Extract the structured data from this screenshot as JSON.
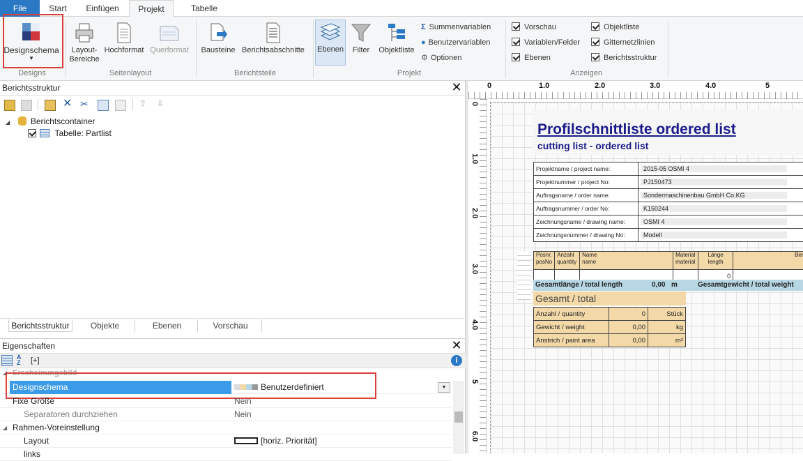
{
  "tabs": [
    {
      "label": "File",
      "kind": "file"
    },
    {
      "label": "Start",
      "kind": "normal"
    },
    {
      "label": "Einfügen",
      "kind": "normal"
    },
    {
      "label": "Projekt",
      "kind": "active"
    },
    {
      "label": "Tabelle",
      "kind": "normal"
    }
  ],
  "ribbon": {
    "designs_group": "Designs",
    "designschema_btn": "Designschema",
    "seitenlayout_group": "Seitenlayout",
    "layout_bereiche_1": "Layout-",
    "layout_bereiche_2": "Bereiche",
    "hochformat": "Hochformat",
    "querformat": "Querformat",
    "berichtsteile_group": "Berichtsteile",
    "bausteine": "Bausteine",
    "berichtsabschnitte": "Berichtsabschnitte",
    "projekt_group": "Projekt",
    "ebenen": "Ebenen",
    "filter": "Filter",
    "objektliste": "Objektliste",
    "summenvariablen": "Summenvariablen",
    "benutzervariablen": "Benutzervariablen",
    "optionen": "Optionen",
    "anzeigen_group": "Anzeigen",
    "checks": [
      "Vorschau",
      "Variablen/Felder",
      "Ebenen",
      "Objektliste",
      "Gitternetzlinien",
      "Berichtsstruktur"
    ]
  },
  "structure_panel": {
    "title": "Berichtsstruktur",
    "tree_root": "Berichtscontainer",
    "tree_child": "Tabelle: Partlist",
    "bottom_tabs": [
      "Berichtsstruktur",
      "Objekte",
      "Ebenen",
      "Vorschau"
    ]
  },
  "properties_panel": {
    "title": "Eigenschaften",
    "sort_label": "[+]",
    "category": "Erscheinungsbild",
    "rows": [
      {
        "name": "Designschema",
        "value": "Benutzerdefiniert"
      },
      {
        "name": "Fixe Größe",
        "value": "Nein"
      },
      {
        "name": "Separatoren durchziehen",
        "value": "Nein"
      },
      {
        "name": "Rahmen-Voreinstellung",
        "value": ""
      },
      {
        "name": "Layout",
        "value": "[horiz. Priorität]"
      },
      {
        "name": "links",
        "value": ""
      }
    ]
  },
  "ruler": {
    "h_labels": [
      "0",
      "1.0",
      "2.0",
      "3.0",
      "4.0",
      "5"
    ],
    "v_labels": [
      "0",
      "1.0",
      "2.0",
      "3.0",
      "4.0",
      "5",
      "6.0"
    ]
  },
  "report": {
    "title": "Profilschnittliste ordered list",
    "subtitle": "cutting list - ordered list",
    "info_rows": [
      {
        "label": "Projektname / project name:",
        "value": "2015-05 OSMI 4"
      },
      {
        "label": "Projektnummer / project No:",
        "value": "PJ150473"
      },
      {
        "label": "Auftragsname / order name:",
        "value": "Sondermaschinenbau GmbH Co.KG"
      },
      {
        "label": "Auftragsnummer / order No:",
        "value": "K150244"
      },
      {
        "label": "Zeichnungsname / drawing name:",
        "value": "OSMI 4"
      },
      {
        "label": "Zeichnungsnummer / drawing No:",
        "value": "Modell"
      }
    ],
    "col_headers": [
      {
        "l1": "Posnr.",
        "l2": "posNo"
      },
      {
        "l1": "Anzahl",
        "l2": "quantity"
      },
      {
        "l1": "Name",
        "l2": "name"
      },
      {
        "l1": "Material",
        "l2": "material"
      },
      {
        "l1": "Länge",
        "l2": "length"
      },
      {
        "l1": "Beme",
        "l2": "no"
      }
    ],
    "zero_value": "0",
    "gesamtlaenge_label": "Gesamtlänge / total length",
    "gesamtlaenge_value": "0,00",
    "gesamtlaenge_unit": "m",
    "gesamtgewicht_label": "Gesamtgewicht / total weight",
    "gesamt_title": "Gesamt / total",
    "totals": [
      {
        "label": "Anzahl / quantity",
        "value": "0",
        "unit": "Stück"
      },
      {
        "label": "Gewicht / weight",
        "value": "0,00",
        "unit": "kg"
      },
      {
        "label": "Anstrich / paint area",
        "value": "0,00",
        "unit": "m²"
      }
    ]
  },
  "colors": {
    "file_tab": "#2b78c5",
    "highlight_red": "#d9403a",
    "selection_blue": "#3c9be8",
    "header_orange": "#f3d9a8",
    "total_blue": "#b7d7e4"
  }
}
